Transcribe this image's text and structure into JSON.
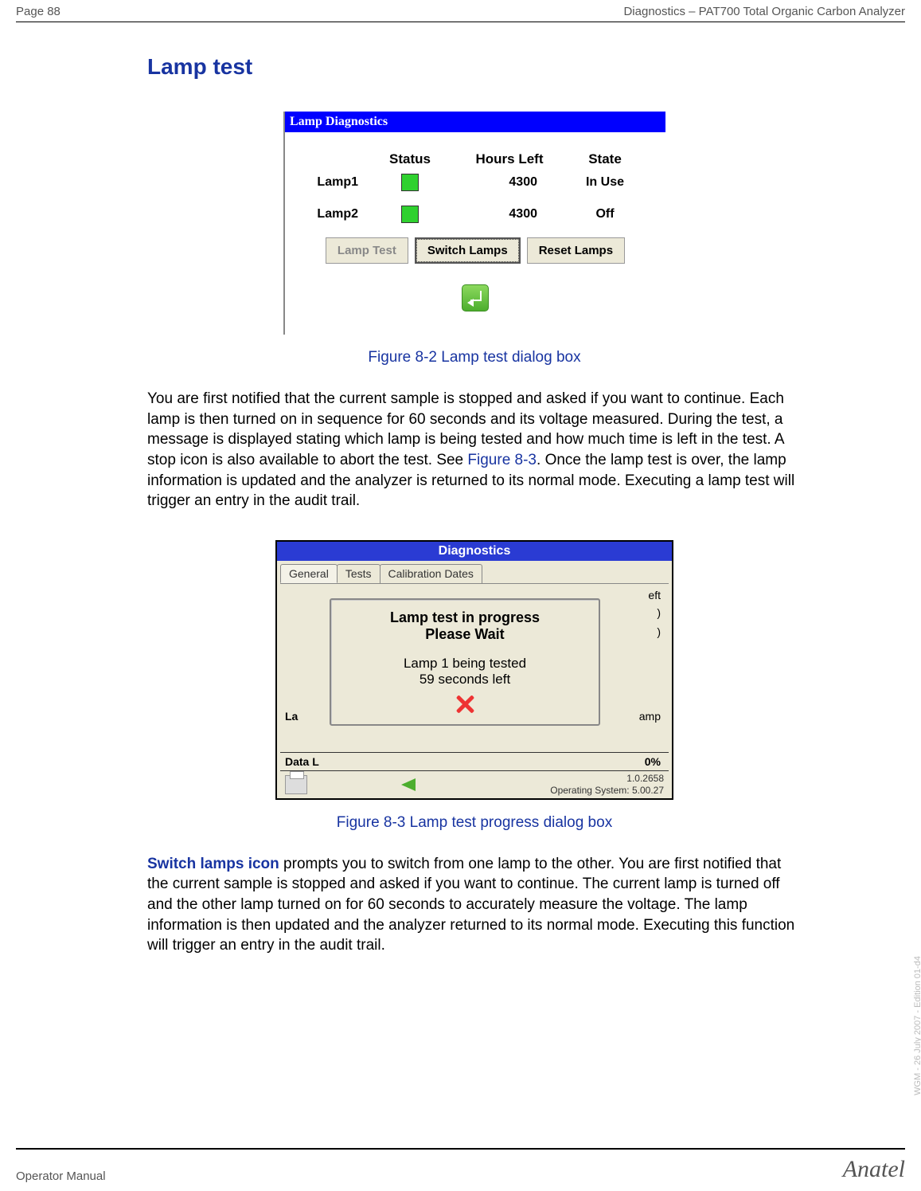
{
  "header": {
    "page_num": "Page 88",
    "doc_title": "Diagnostics – PAT700 Total Organic Carbon Analyzer"
  },
  "section_title": "Lamp test",
  "lamp_dialog": {
    "title": "Lamp Diagnostics",
    "headers": {
      "status": "Status",
      "hours": "Hours Left",
      "state": "State"
    },
    "rows": [
      {
        "name": "Lamp1",
        "hours": "4300",
        "state": "In Use"
      },
      {
        "name": "Lamp2",
        "hours": "4300",
        "state": "Off"
      }
    ],
    "buttons": {
      "lamp_test": "Lamp Test",
      "switch_lamps": "Switch Lamps",
      "reset_lamps": "Reset Lamps"
    }
  },
  "figure1_caption": "Figure 8-2 Lamp test dialog box",
  "para1_a": "You are first notified that the current sample is stopped and asked if you want to continue. Each lamp is then turned on in sequence for 60 seconds and its voltage measured. During the test, a message is displayed stating which lamp is being tested and how much time is left in the test. A stop icon is also available to abort the test. See ",
  "para1_link": "Figure 8-3",
  "para1_b": ". Once the lamp test is over, the lamp information is updated and the analyzer is returned to its normal mode. Executing a lamp test will trigger an entry in the audit trail.",
  "diag_dialog": {
    "title": "Diagnostics",
    "tabs": {
      "general": "General",
      "tests": "Tests",
      "calib": "Calibration Dates"
    },
    "bg_frag1": "eft",
    "bg_frag2": "amp",
    "bg_left1": "La",
    "modal": {
      "line1": "Lamp test in progress",
      "line2": "Please Wait",
      "line3": "Lamp 1 being tested",
      "line4": "59  seconds left"
    },
    "datalog_label": "Data L",
    "datalog_val": "0%",
    "footer_ver": "1.0.2658",
    "footer_os": "Operating System: 5.00.27"
  },
  "figure2_caption": "Figure 8-3 Lamp test progress dialog box",
  "para2_lead": "Switch lamps icon",
  "para2_body": " prompts you to switch from one lamp to the other. You are first notified that the current sample is stopped and asked if you want to continue. The current lamp is turned off and the other lamp turned on for 60 seconds to accurately measure the voltage. The lamp information is then updated and the analyzer returned to its normal mode. Executing this function will trigger an entry in the audit trail.",
  "footer": {
    "left": "Operator Manual",
    "right": "Anatel"
  },
  "watermark": "WGM - 26 July 2007 - Edition 01-d4"
}
